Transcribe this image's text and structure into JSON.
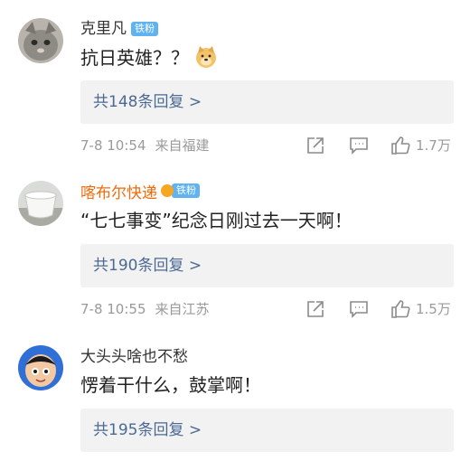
{
  "comments": [
    {
      "username": "克里凡",
      "badge": "铁粉",
      "text": "抗日英雄？？",
      "emoji": "doge-emoji",
      "replies": "共148条回复 >",
      "time": "7-8 10:54",
      "location": "来自福建",
      "likes": "1.7万"
    },
    {
      "username": "喀布尔快递",
      "badge": "铁粉",
      "text": "“七七事变”纪念日刚过去一天啊！",
      "replies": "共190条回复 >",
      "time": "7-8 10:55",
      "location": "来自江苏",
      "likes": "1.5万"
    },
    {
      "username": "大头头啥也不愁",
      "text": "愣着干什么，鼓掌啊！",
      "replies": "共195条回复 >",
      "time": "",
      "location": "",
      "likes": ""
    }
  ],
  "colors": {
    "username_default": "#333333",
    "username_vip": "#f36a0a",
    "badge_blue": "#5fb3f0",
    "reply_link": "#4b6a93",
    "meta_gray": "#9a9a9a",
    "reply_bg": "#f2f2f2"
  },
  "icons": [
    "share-icon",
    "comment-icon",
    "like-icon"
  ]
}
